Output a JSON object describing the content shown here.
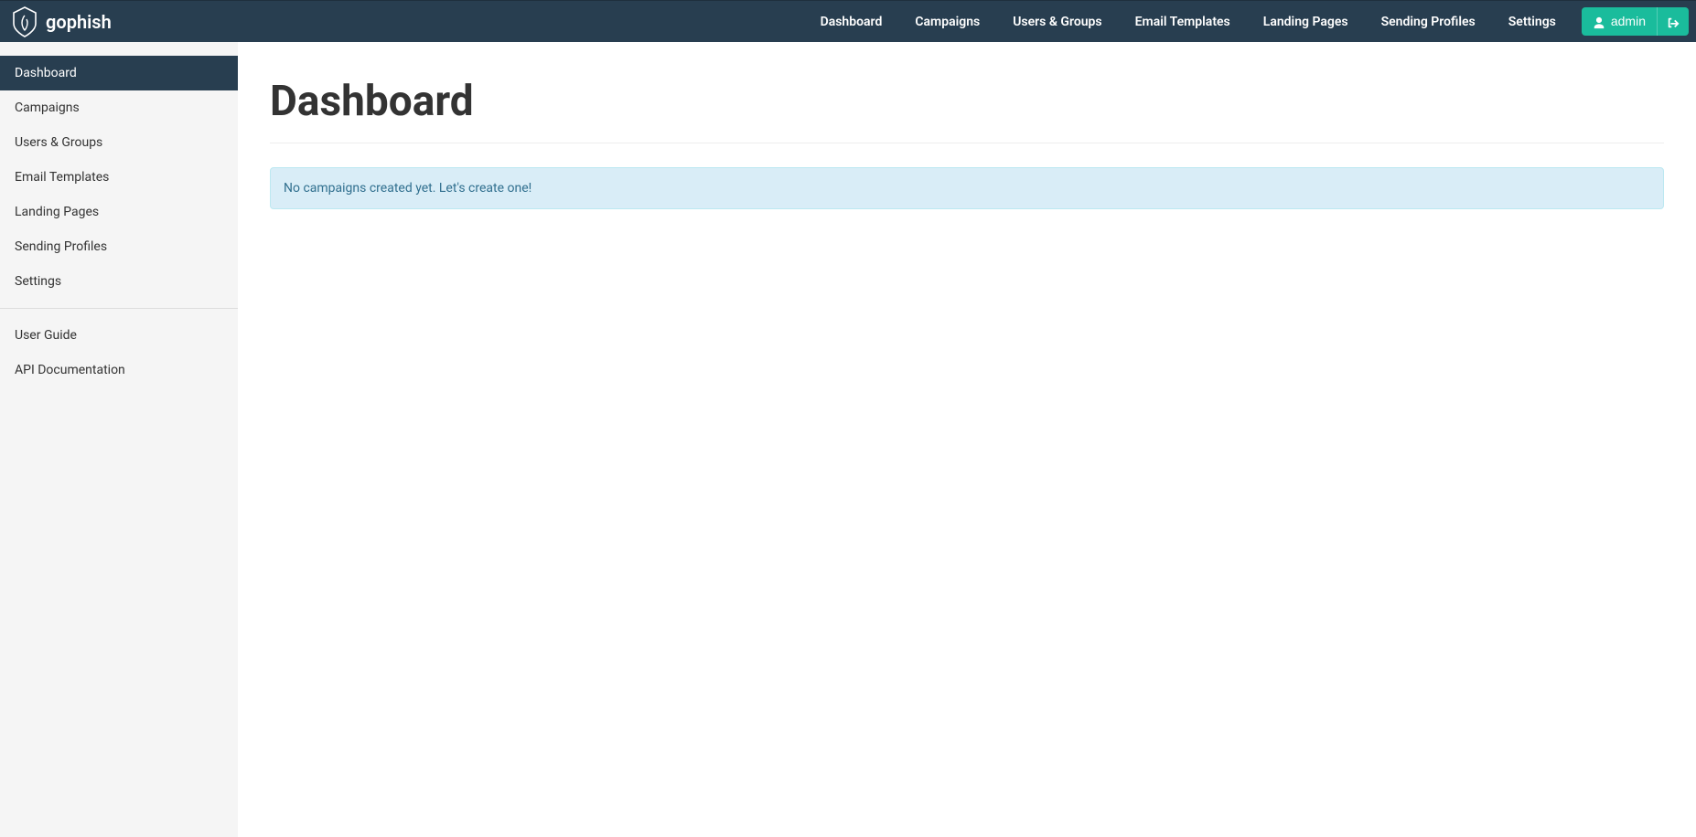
{
  "brand": {
    "name": "gophish"
  },
  "topnav": {
    "items": [
      {
        "label": "Dashboard"
      },
      {
        "label": "Campaigns"
      },
      {
        "label": "Users & Groups"
      },
      {
        "label": "Email Templates"
      },
      {
        "label": "Landing Pages"
      },
      {
        "label": "Sending Profiles"
      },
      {
        "label": "Settings"
      }
    ],
    "admin_label": "admin"
  },
  "sidebar": {
    "items": [
      {
        "label": "Dashboard",
        "active": true
      },
      {
        "label": "Campaigns"
      },
      {
        "label": "Users & Groups"
      },
      {
        "label": "Email Templates"
      },
      {
        "label": "Landing Pages"
      },
      {
        "label": "Sending Profiles"
      },
      {
        "label": "Settings"
      }
    ],
    "secondary": [
      {
        "label": "User Guide"
      },
      {
        "label": "API Documentation"
      }
    ]
  },
  "main": {
    "title": "Dashboard",
    "alert": "No campaigns created yet. Let's create one!"
  }
}
